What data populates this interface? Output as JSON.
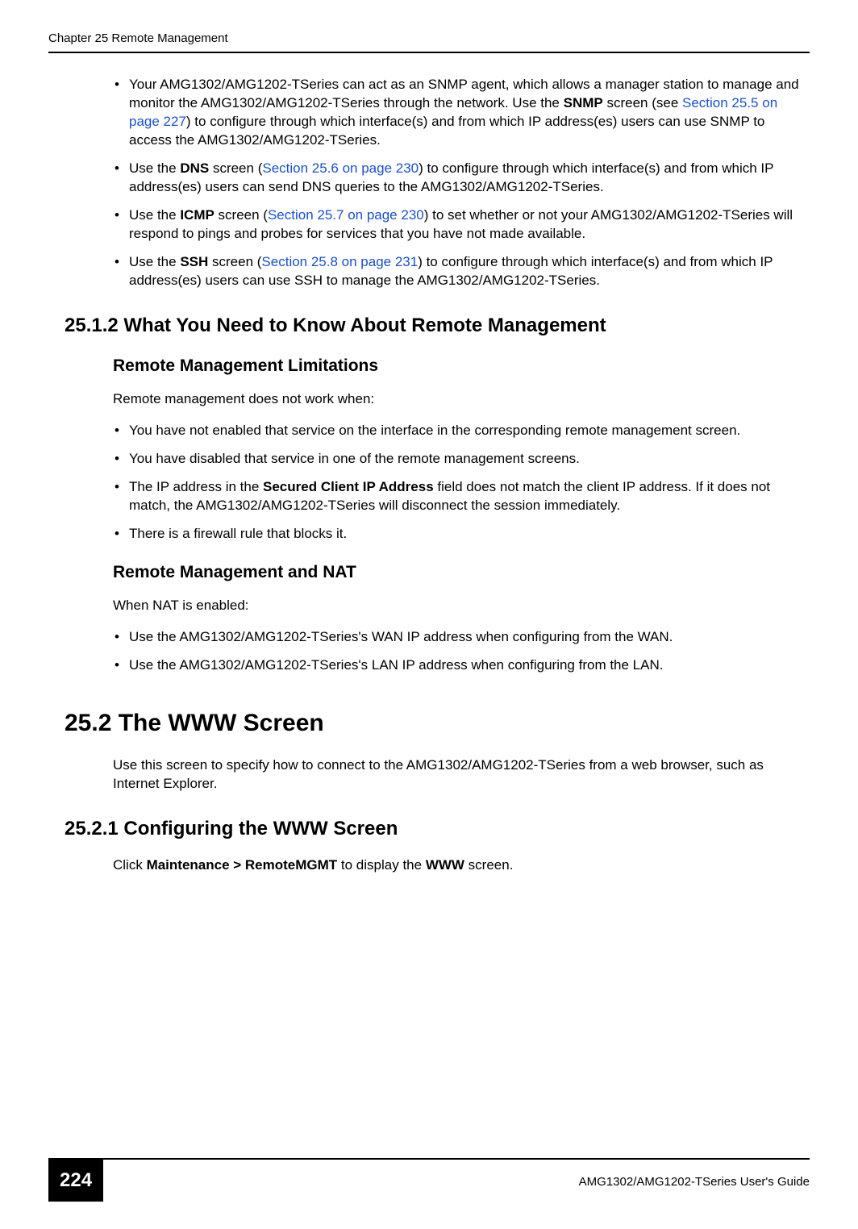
{
  "header": {
    "left": "Chapter 25 Remote Management",
    "right": ""
  },
  "bullets_top": [
    {
      "pre": "Your AMG1302/AMG1202-TSeries can act as an SNMP agent, which allows a manager station to manage and monitor the AMG1302/AMG1202-TSeries through the network. Use the ",
      "bold1": "SNMP",
      "mid1": " screen (see ",
      "link": "Section 25.5 on page 227",
      "post": ") to configure through which interface(s) and from which IP address(es) users can use SNMP to access the AMG1302/AMG1202-TSeries."
    },
    {
      "pre": "Use the ",
      "bold1": "DNS",
      "mid1": " screen (",
      "link": "Section 25.6 on page 230",
      "post": ") to configure through which interface(s) and from which IP address(es) users can send DNS queries to the AMG1302/AMG1202-TSeries."
    },
    {
      "pre": "Use the ",
      "bold1": "ICMP",
      "mid1": " screen (",
      "link": "Section 25.7 on page 230",
      "post": ") to set whether or not your AMG1302/AMG1202-TSeries will respond to pings and probes for services that you have not made available."
    },
    {
      "pre": "Use the ",
      "bold1": "SSH",
      "mid1": " screen (",
      "link": "Section 25.8 on page 231",
      "post": ") to configure through which interface(s) and from which IP address(es) users can use SSH to manage the AMG1302/AMG1202-TSeries."
    }
  ],
  "section_2512": {
    "heading": "25.1.2  What You Need to Know About Remote Management",
    "sub1_heading": "Remote Management Limitations",
    "sub1_intro": "Remote management does not work when:",
    "sub1_bullets": [
      "You have not enabled that service on the interface in the corresponding remote management screen.",
      "You have disabled that service in one of the remote management screens.",
      {
        "pre": "The IP address in the ",
        "bold": "Secured Client IP Address",
        "post": " field does not match the client IP address. If it does not match, the AMG1302/AMG1202-TSeries will disconnect the session immediately."
      },
      "There is a firewall rule that blocks it."
    ],
    "sub2_heading": "Remote Management and NAT",
    "sub2_intro": "When NAT is enabled:",
    "sub2_bullets": [
      "Use the AMG1302/AMG1202-TSeries's WAN IP address when configuring from the WAN.",
      "Use the AMG1302/AMG1202-TSeries's LAN IP address when configuring from the LAN."
    ]
  },
  "section_252": {
    "heading": "25.2  The WWW Screen",
    "body": "Use this screen to specify how to connect to the AMG1302/AMG1202-TSeries from a web browser, such as Internet Explorer."
  },
  "section_2521": {
    "heading": "25.2.1  Configuring the WWW Screen",
    "body_pre": "Click ",
    "body_bold1": "Maintenance > RemoteMGMT",
    "body_mid": " to display the ",
    "body_bold2": "WWW",
    "body_post": " screen."
  },
  "footer": {
    "page_number": "224",
    "guide": "AMG1302/AMG1202-TSeries User's Guide"
  }
}
